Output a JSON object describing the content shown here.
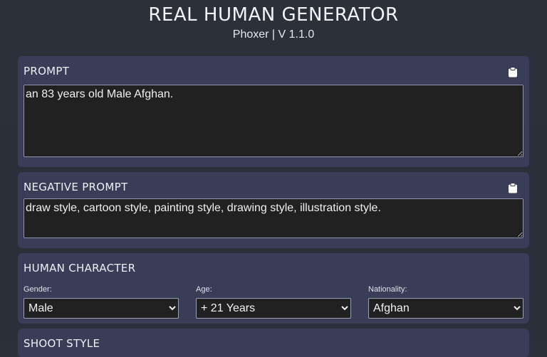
{
  "app": {
    "title": "REAL HUMAN GENERATOR",
    "subtitle": "Phoxer | V 1.1.0"
  },
  "prompt": {
    "title": "PROMPT",
    "value": "an 83 years old Male Afghan.",
    "copy_icon": "clipboard-icon"
  },
  "negative_prompt": {
    "title": "NEGATIVE PROMPT",
    "value": "draw style, cartoon style, painting style, drawing style, illustration style.",
    "copy_icon": "clipboard-icon"
  },
  "human_character": {
    "title": "HUMAN CHARACTER",
    "gender": {
      "label": "Gender:",
      "selected": "Male"
    },
    "age": {
      "label": "Age:",
      "selected": "+ 21 Years"
    },
    "nationality": {
      "label": "Nationality:",
      "selected": "Afghan"
    }
  },
  "shoot_style": {
    "title": "SHOOT STYLE"
  },
  "colors": {
    "background": "#2b303b",
    "panel": "#393d57",
    "field": "#212121"
  }
}
